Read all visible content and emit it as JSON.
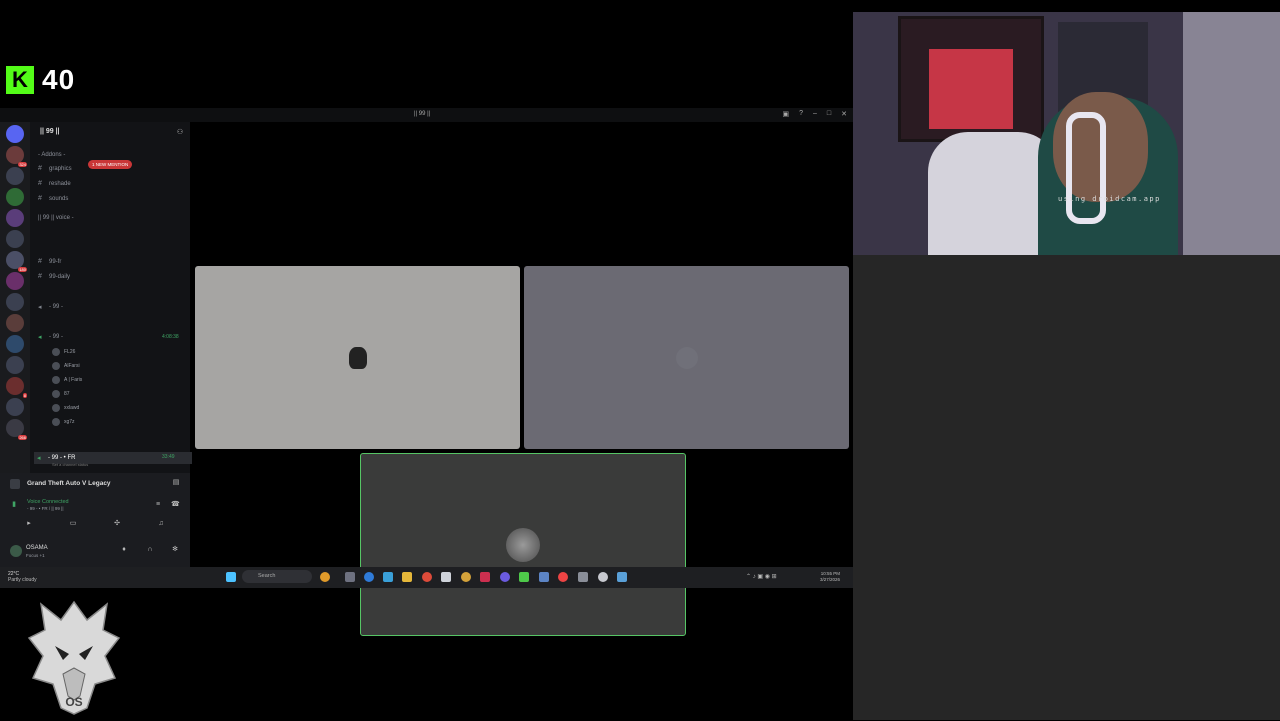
{
  "kick": {
    "label": "K",
    "viewers": "40"
  },
  "discord": {
    "window_title": "|| 99 ||",
    "server_name": "|| 99 ||",
    "new_mention": "1 NEW MENTION",
    "channels": [
      {
        "label": "graphics",
        "type": "text"
      },
      {
        "label": "reshade",
        "type": "text"
      },
      {
        "label": "sounds",
        "type": "text"
      },
      {
        "label": "99-fr",
        "type": "text"
      },
      {
        "label": "99-daily",
        "type": "text"
      },
      {
        "label": "- 99 -",
        "type": "voice"
      },
      {
        "label": "- 99 -",
        "type": "voice"
      }
    ],
    "categories": [
      "- Addons -",
      "|| 99 || voice -"
    ],
    "voice_users": [
      "FL26",
      "AlFarsi",
      "A | Faris",
      "87",
      "xxlawd",
      "xg7z"
    ],
    "selected_channel": "- 99 - • FR",
    "selected_channel_sub": "Set a channel status",
    "call_time": "4:08:38",
    "selected_time": "33:49"
  },
  "panel": {
    "game": "Grand Theft Auto V Legacy",
    "voice_status": "Voice Connected",
    "voice_sub": "- 99 - • FR / || 99 ||",
    "username": "OSAMA",
    "user_status": "Focus +1"
  },
  "taskbar": {
    "temp": "22°C",
    "weather": "Partly cloudy",
    "search": "Search",
    "time": "10:55 PM",
    "date": "3/27/2026"
  },
  "webcam": {
    "watermark": "using droidcam.app"
  },
  "logo": {
    "text": "OS"
  }
}
